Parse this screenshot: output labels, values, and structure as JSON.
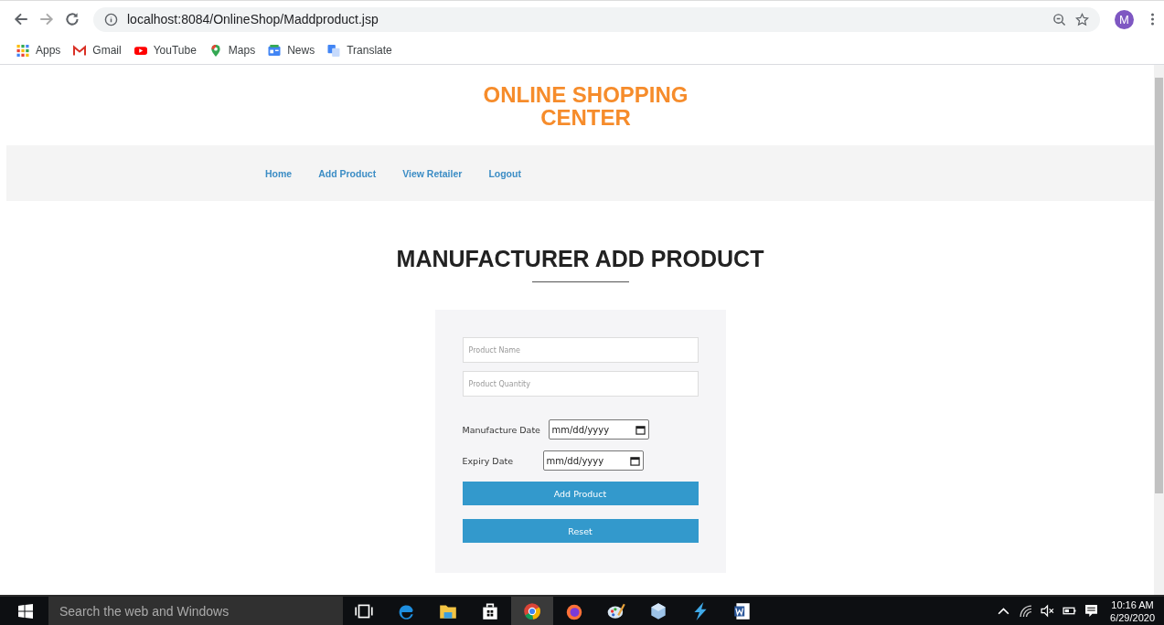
{
  "browser": {
    "url": "localhost:8084/OnlineShop/Maddproduct.jsp",
    "avatar": "M",
    "bookmarks": [
      {
        "label": "Apps",
        "kind": "apps"
      },
      {
        "label": "Gmail",
        "kind": "gmail"
      },
      {
        "label": "YouTube",
        "kind": "youtube"
      },
      {
        "label": "Maps",
        "kind": "maps"
      },
      {
        "label": "News",
        "kind": "news"
      },
      {
        "label": "Translate",
        "kind": "translate"
      }
    ]
  },
  "site": {
    "title_lines": [
      "ONLINE SHOPPING",
      "CENTER"
    ],
    "nav": [
      "Home",
      "Add Product",
      "View Retailer",
      "Logout"
    ]
  },
  "heading": "MANUFACTURER ADD PRODUCT",
  "form": {
    "fields": [
      {
        "placeholder": "Product Name"
      },
      {
        "placeholder": "Product Quantity"
      }
    ],
    "dates": [
      {
        "label": "Manufacture Date",
        "value": "mm/dd/yyyy"
      },
      {
        "label": "Expiry Date",
        "value": "mm/dd/yyyy"
      }
    ],
    "buttons": [
      "Add Product",
      "Reset"
    ]
  },
  "taskbar": {
    "search_placeholder": "Search the web and Windows",
    "apps": [
      {
        "kind": "taskview",
        "selected": false
      },
      {
        "kind": "edge",
        "selected": false
      },
      {
        "kind": "folder",
        "selected": false
      },
      {
        "kind": "store",
        "selected": false
      },
      {
        "kind": "chrome",
        "selected": true
      },
      {
        "kind": "firefox",
        "selected": false
      },
      {
        "kind": "paint",
        "selected": false
      },
      {
        "kind": "cube",
        "selected": false
      },
      {
        "kind": "bolt",
        "selected": false
      },
      {
        "kind": "word",
        "selected": false
      }
    ],
    "time": "10:16 AM",
    "date": "6/29/2020"
  }
}
